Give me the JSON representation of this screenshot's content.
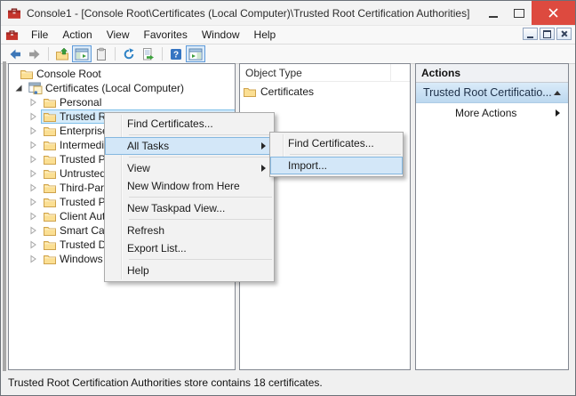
{
  "titlebar": {
    "title": "Console1 - [Console Root\\Certificates (Local Computer)\\Trusted Root Certification Authorities]"
  },
  "menubar": {
    "items": [
      "File",
      "Action",
      "View",
      "Favorites",
      "Window",
      "Help"
    ]
  },
  "toolbar": {
    "buttons": [
      "back",
      "forward",
      "up-one-level",
      "show-console-tree",
      "properties",
      "refresh",
      "export-list",
      "help",
      "show-action-pane"
    ],
    "toggled": [
      "show-console-tree",
      "show-action-pane"
    ]
  },
  "tree": {
    "items": [
      {
        "label": "Console Root",
        "level": 0,
        "twisty": "none",
        "icon": "folder"
      },
      {
        "label": "Certificates (Local Computer)",
        "level": 1,
        "twisty": "expanded",
        "icon": "certificates"
      },
      {
        "label": "Personal",
        "level": 2,
        "twisty": "collapsed",
        "icon": "folder"
      },
      {
        "label": "Trusted Root Certification Authorities",
        "level": 2,
        "twisty": "collapsed",
        "icon": "folder",
        "selected": true
      },
      {
        "label": "Enterprise Trust",
        "level": 2,
        "twisty": "collapsed",
        "icon": "folder"
      },
      {
        "label": "Intermediate Certification Authorities",
        "level": 2,
        "twisty": "collapsed",
        "icon": "folder"
      },
      {
        "label": "Trusted Publishers",
        "level": 2,
        "twisty": "collapsed",
        "icon": "folder"
      },
      {
        "label": "Untrusted Certificates",
        "level": 2,
        "twisty": "collapsed",
        "icon": "folder"
      },
      {
        "label": "Third-Party Root Certification Authorities",
        "level": 2,
        "twisty": "collapsed",
        "icon": "folder"
      },
      {
        "label": "Trusted People",
        "level": 2,
        "twisty": "collapsed",
        "icon": "folder"
      },
      {
        "label": "Client Authentication Issuers",
        "level": 2,
        "twisty": "collapsed",
        "icon": "folder"
      },
      {
        "label": "Smart Card Trusted Roots",
        "level": 2,
        "twisty": "collapsed",
        "icon": "folder"
      },
      {
        "label": "Trusted Devices",
        "level": 2,
        "twisty": "collapsed",
        "icon": "folder"
      },
      {
        "label": "Windows Live ID Token Issuer",
        "level": 2,
        "twisty": "collapsed",
        "icon": "folder"
      }
    ]
  },
  "list_pane": {
    "column_header": "Object Type",
    "items": [
      "Certificates"
    ]
  },
  "actions_pane": {
    "header": "Actions",
    "group_title": "Trusted Root Certificatio...",
    "more_actions": "More Actions"
  },
  "context_menu": {
    "items": [
      {
        "type": "item",
        "label": "Find Certificates..."
      },
      {
        "type": "separator"
      },
      {
        "type": "item",
        "label": "All Tasks",
        "submenu": true,
        "highlighted": true
      },
      {
        "type": "separator"
      },
      {
        "type": "item",
        "label": "View",
        "submenu": true
      },
      {
        "type": "item",
        "label": "New Window from Here"
      },
      {
        "type": "separator"
      },
      {
        "type": "item",
        "label": "New Taskpad View..."
      },
      {
        "type": "separator"
      },
      {
        "type": "item",
        "label": "Refresh"
      },
      {
        "type": "item",
        "label": "Export List..."
      },
      {
        "type": "separator"
      },
      {
        "type": "item",
        "label": "Help"
      }
    ]
  },
  "submenu": {
    "items": [
      {
        "type": "item",
        "label": "Find Certificates..."
      },
      {
        "type": "separator"
      },
      {
        "type": "item",
        "label": "Import...",
        "highlighted": true
      }
    ]
  },
  "statusbar": {
    "text": "Trusted Root Certification Authorities store contains 18 certificates."
  },
  "colors": {
    "selection_fill": "#d5ebfa",
    "selection_border": "#7fc0ea",
    "close_button": "#dd4a3f",
    "folder": "#fbdf93",
    "actions_group_top": "#daebf9",
    "actions_group_bottom": "#bcd8ef"
  }
}
